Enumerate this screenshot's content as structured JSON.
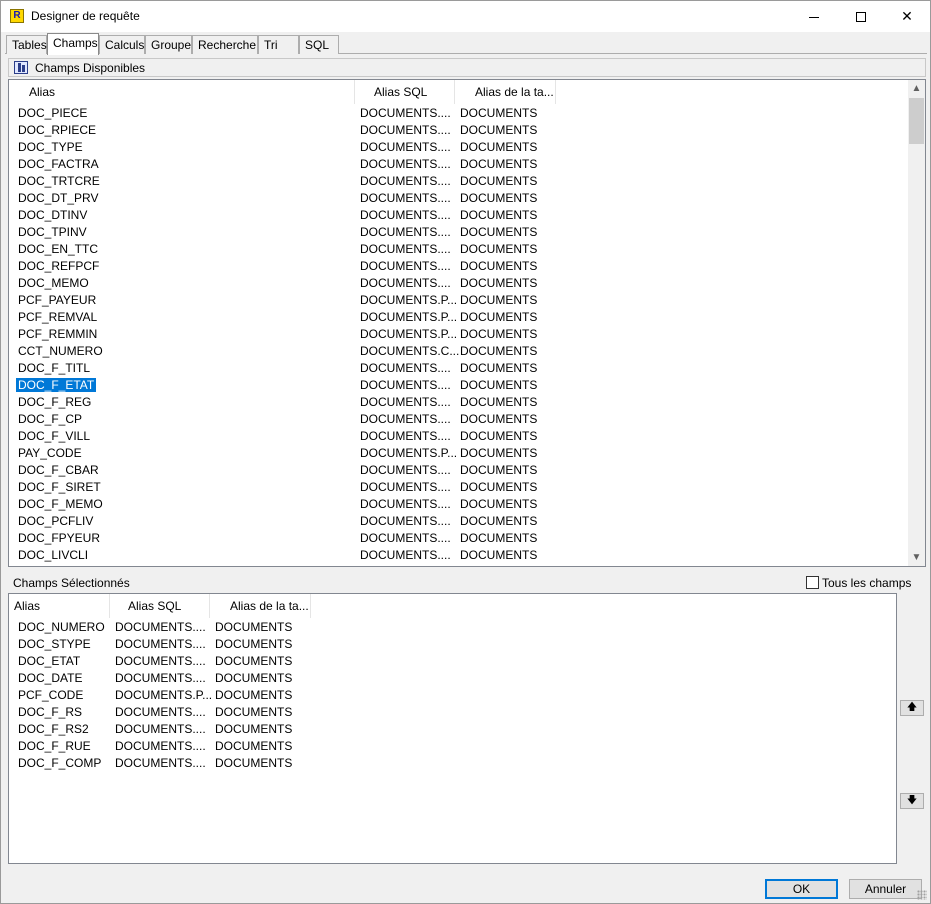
{
  "window": {
    "title": "Designer de requête",
    "app_icon": "R",
    "controls": {
      "minimize": "minimize-icon",
      "maximize": "maximize-icon",
      "close": "✕"
    }
  },
  "tabs": [
    "Tables",
    "Champs",
    "Calculs",
    "Groupe",
    "Recherche",
    "Tri",
    "SQL"
  ],
  "active_tab": "Champs",
  "available": {
    "section_title": "Champs Disponibles",
    "columns": [
      "Alias",
      "Alias SQL",
      "Alias de la ta..."
    ],
    "selected_alias": "DOC_F_ETAT",
    "rows": [
      [
        "DOC_PIECE",
        "DOCUMENTS....",
        "DOCUMENTS"
      ],
      [
        "DOC_RPIECE",
        "DOCUMENTS....",
        "DOCUMENTS"
      ],
      [
        "DOC_TYPE",
        "DOCUMENTS....",
        "DOCUMENTS"
      ],
      [
        "DOC_FACTRA",
        "DOCUMENTS....",
        "DOCUMENTS"
      ],
      [
        "DOC_TRTCRE",
        "DOCUMENTS....",
        "DOCUMENTS"
      ],
      [
        "DOC_DT_PRV",
        "DOCUMENTS....",
        "DOCUMENTS"
      ],
      [
        "DOC_DTINV",
        "DOCUMENTS....",
        "DOCUMENTS"
      ],
      [
        "DOC_TPINV",
        "DOCUMENTS....",
        "DOCUMENTS"
      ],
      [
        "DOC_EN_TTC",
        "DOCUMENTS....",
        "DOCUMENTS"
      ],
      [
        "DOC_REFPCF",
        "DOCUMENTS....",
        "DOCUMENTS"
      ],
      [
        "DOC_MEMO",
        "DOCUMENTS....",
        "DOCUMENTS"
      ],
      [
        "PCF_PAYEUR",
        "DOCUMENTS.P...",
        "DOCUMENTS"
      ],
      [
        "PCF_REMVAL",
        "DOCUMENTS.P...",
        "DOCUMENTS"
      ],
      [
        "PCF_REMMIN",
        "DOCUMENTS.P...",
        "DOCUMENTS"
      ],
      [
        "CCT_NUMERO",
        "DOCUMENTS.C...",
        "DOCUMENTS"
      ],
      [
        "DOC_F_TITL",
        "DOCUMENTS....",
        "DOCUMENTS"
      ],
      [
        "DOC_F_ETAT",
        "DOCUMENTS....",
        "DOCUMENTS"
      ],
      [
        "DOC_F_REG",
        "DOCUMENTS....",
        "DOCUMENTS"
      ],
      [
        "DOC_F_CP",
        "DOCUMENTS....",
        "DOCUMENTS"
      ],
      [
        "DOC_F_VILL",
        "DOCUMENTS....",
        "DOCUMENTS"
      ],
      [
        "PAY_CODE",
        "DOCUMENTS.P...",
        "DOCUMENTS"
      ],
      [
        "DOC_F_CBAR",
        "DOCUMENTS....",
        "DOCUMENTS"
      ],
      [
        "DOC_F_SIRET",
        "DOCUMENTS....",
        "DOCUMENTS"
      ],
      [
        "DOC_F_MEMO",
        "DOCUMENTS....",
        "DOCUMENTS"
      ],
      [
        "DOC_PCFLIV",
        "DOCUMENTS....",
        "DOCUMENTS"
      ],
      [
        "DOC_FPYEUR",
        "DOCUMENTS....",
        "DOCUMENTS"
      ],
      [
        "DOC_LIVCLI",
        "DOCUMENTS....",
        "DOCUMENTS"
      ]
    ],
    "scroll_up": "▲",
    "scroll_down": "▼"
  },
  "selected": {
    "section_title": "Champs Sélectionnés",
    "all_fields_label": "Tous les champs",
    "all_fields_checked": false,
    "columns": [
      "Alias",
      "Alias SQL",
      "Alias de la ta..."
    ],
    "rows": [
      [
        "DOC_NUMERO",
        "DOCUMENTS....",
        "DOCUMENTS"
      ],
      [
        "DOC_STYPE",
        "DOCUMENTS....",
        "DOCUMENTS"
      ],
      [
        "DOC_ETAT",
        "DOCUMENTS....",
        "DOCUMENTS"
      ],
      [
        "DOC_DATE",
        "DOCUMENTS....",
        "DOCUMENTS"
      ],
      [
        "PCF_CODE",
        "DOCUMENTS.P...",
        "DOCUMENTS"
      ],
      [
        "DOC_F_RS",
        "DOCUMENTS....",
        "DOCUMENTS"
      ],
      [
        "DOC_F_RS2",
        "DOCUMENTS....",
        "DOCUMENTS"
      ],
      [
        "DOC_F_RUE",
        "DOCUMENTS....",
        "DOCUMENTS"
      ],
      [
        "DOC_F_COMP",
        "DOCUMENTS....",
        "DOCUMENTS"
      ]
    ],
    "move_up": "🡅",
    "move_down": "🡇"
  },
  "buttons": {
    "ok": "OK",
    "cancel": "Annuler"
  },
  "colors": {
    "selection": "#0078d7",
    "window_bg": "#f0f0f0"
  }
}
